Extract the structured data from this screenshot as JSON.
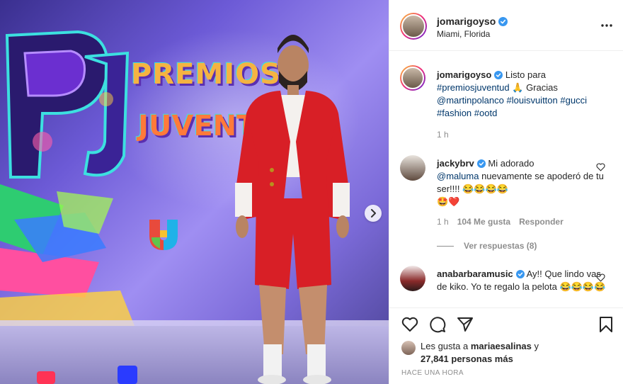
{
  "post": {
    "username": "jomarigoyso",
    "location": "Miami, Florida",
    "photo_sign": {
      "line1": "PREMIOS",
      "line2": "JUVENTUD"
    }
  },
  "caption": {
    "username": "jomarigoyso",
    "text_before": "Listo para",
    "tags": [
      "#premiosjuventud",
      "@martinpolanco",
      "#louisvuitton",
      "#gucci",
      "#fashion",
      "#ootd"
    ],
    "gracias": "Gracias",
    "time": "1 h"
  },
  "comments": [
    {
      "username": "jackybrv",
      "text_before": "Mi adorado",
      "mention": "@maluma",
      "text_after": "nuevamente se apoderó de tu ser!!!!",
      "time": "1 h",
      "likes": "104 Me gusta",
      "reply": "Responder",
      "view_replies": "Ver respuestas (8)"
    },
    {
      "username": "anabarbaramusic",
      "text": "Ay!! Que lindo vas de kiko. Yo te regalo la pelota"
    }
  ],
  "footer": {
    "likes_prefix": "Les gusta a",
    "likes_user": "mariaesalinas",
    "likes_joiner": "y",
    "likes_count": "27,841 personas más",
    "timestamp": "HACE UNA HORA"
  },
  "icons": {
    "verified": "verified-icon",
    "more": "more-options-icon",
    "like": "heart-icon",
    "comment": "comment-icon",
    "share": "share-icon",
    "save": "bookmark-icon",
    "next": "chevron-right-icon"
  },
  "colors": {
    "link": "#00376b",
    "verified": "#3897f0",
    "muted": "#8e8e8e",
    "suit": "#d81f26"
  }
}
